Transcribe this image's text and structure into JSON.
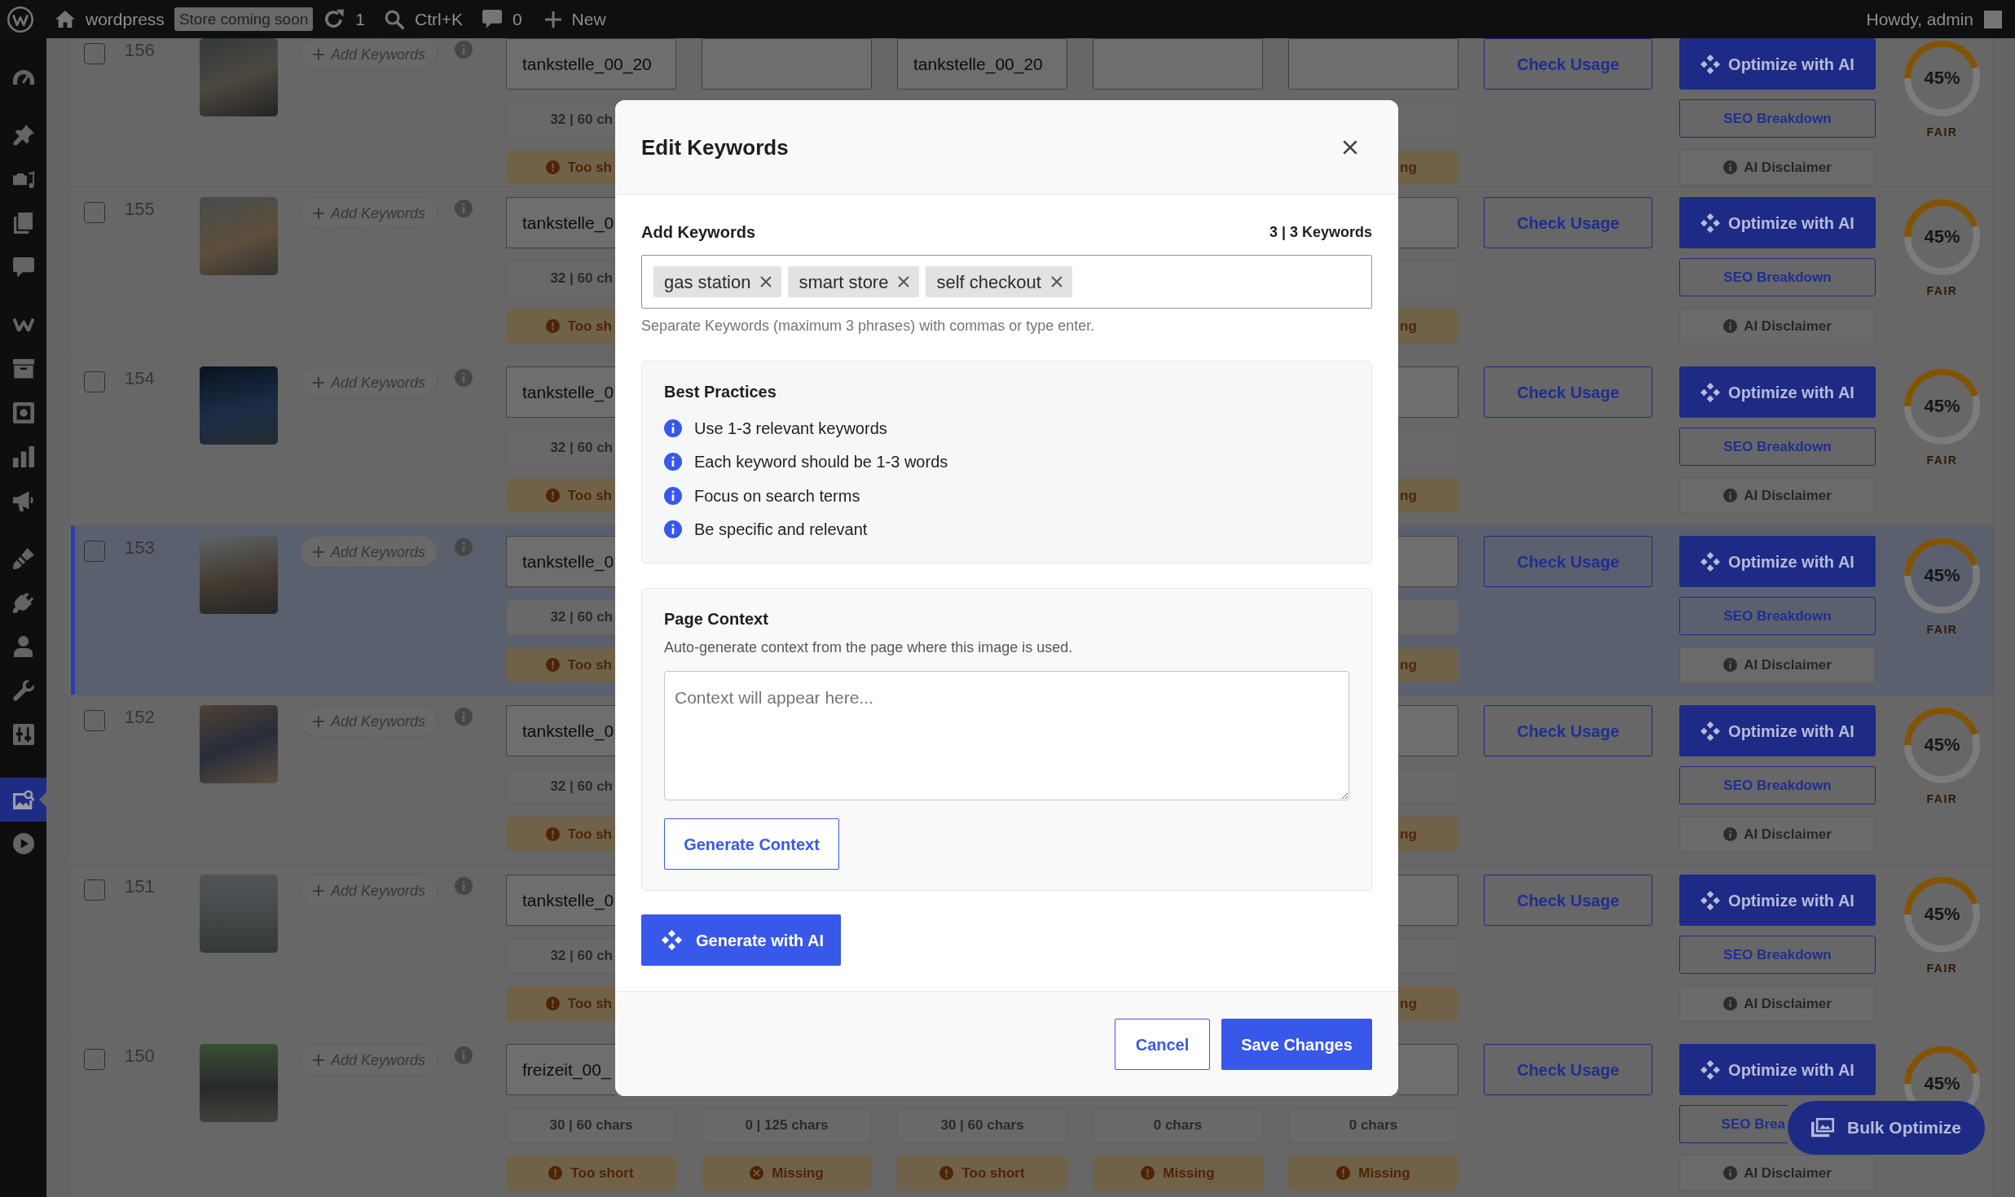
{
  "admin_bar": {
    "site_name": "wordpress",
    "badge": "Store coming soon",
    "updates": "1",
    "search_hint": "Ctrl+K",
    "comments": "0",
    "new_label": "New",
    "greeting": "Howdy, admin"
  },
  "admin_menu": {
    "groups": [
      {
        "items": [
          {
            "selected": false
          }
        ]
      },
      {
        "items": [
          {
            "selected": false
          },
          {
            "selected": false
          },
          {
            "selected": false
          },
          {
            "selected": false
          }
        ]
      },
      {
        "items": [
          {
            "selected": false
          },
          {
            "selected": false
          },
          {
            "selected": false
          },
          {
            "selected": false
          },
          {
            "selected": false
          }
        ]
      },
      {
        "items": [
          {
            "selected": false
          },
          {
            "selected": false
          },
          {
            "selected": false
          },
          {
            "selected": false
          },
          {
            "selected": false
          }
        ]
      },
      {
        "items": [
          {
            "selected": true
          },
          {
            "selected": false
          }
        ]
      }
    ]
  },
  "rows": [
    {
      "number": "156",
      "checked": false,
      "selected": false,
      "keywords_button": "Add Keywords",
      "column_1": {
        "value": "tankstelle_00_20",
        "count": "32 | 60 ch",
        "status": "Too sh",
        "kind": "warning"
      },
      "column_3": {
        "value": "tankstelle_00_20"
      },
      "column_5": {
        "status": "ng"
      },
      "usage_button": "Check Usage",
      "optimize_button": "Optimize with AI",
      "breakdown_button": "SEO Breakdown",
      "disclaimer_button": "AI Disclaimer",
      "score": {
        "value": "45%",
        "level": 0.45,
        "rating": "FAIR"
      }
    },
    {
      "number": "155",
      "checked": false,
      "selected": false,
      "keywords_button": "Add Keywords",
      "column_1": {
        "value": "tankstelle_0",
        "count": "32 | 60 ch",
        "status": "Too sh",
        "kind": "warning"
      },
      "column_5": {
        "status": "ng"
      },
      "usage_button": "Check Usage",
      "optimize_button": "Optimize with AI",
      "breakdown_button": "SEO Breakdown",
      "disclaimer_button": "AI Disclaimer",
      "score": {
        "value": "45%",
        "level": 0.45,
        "rating": "FAIR"
      }
    },
    {
      "number": "154",
      "checked": false,
      "selected": false,
      "keywords_button": "Add Keywords",
      "column_1": {
        "value": "tankstelle_0",
        "count": "32 | 60 ch",
        "status": "Too sh",
        "kind": "warning"
      },
      "column_5": {
        "status": "ng"
      },
      "usage_button": "Check Usage",
      "optimize_button": "Optimize with AI",
      "breakdown_button": "SEO Breakdown",
      "disclaimer_button": "AI Disclaimer",
      "score": {
        "value": "45%",
        "level": 0.45,
        "rating": "FAIR"
      }
    },
    {
      "number": "153",
      "checked": false,
      "selected": true,
      "keywords_button": "Add Keywords",
      "column_1": {
        "value": "tankstelle_0",
        "count": "32 | 60 ch",
        "status": "Too sh",
        "kind": "warning"
      },
      "column_5": {
        "status": "ng"
      },
      "usage_button": "Check Usage",
      "optimize_button": "Optimize with AI",
      "breakdown_button": "SEO Breakdown",
      "disclaimer_button": "AI Disclaimer",
      "score": {
        "value": "45%",
        "level": 0.45,
        "rating": "FAIR"
      }
    },
    {
      "number": "152",
      "checked": false,
      "selected": false,
      "keywords_button": "Add Keywords",
      "column_1": {
        "value": "tankstelle_0",
        "count": "32 | 60 ch",
        "status": "Too sh",
        "kind": "warning"
      },
      "column_5": {
        "status": "ng"
      },
      "usage_button": "Check Usage",
      "optimize_button": "Optimize with AI",
      "breakdown_button": "SEO Breakdown",
      "disclaimer_button": "AI Disclaimer",
      "score": {
        "value": "45%",
        "level": 0.45,
        "rating": "FAIR"
      }
    },
    {
      "number": "151",
      "checked": false,
      "selected": false,
      "keywords_button": "Add Keywords",
      "column_1": {
        "value": "tankstelle_0",
        "count": "32 | 60 ch",
        "status": "Too sh",
        "kind": "warning"
      },
      "column_5": {
        "status": "ng"
      },
      "usage_button": "Check Usage",
      "optimize_button": "Optimize with AI",
      "breakdown_button": "SEO Breakdown",
      "disclaimer_button": "AI Disclaimer",
      "score": {
        "value": "45%",
        "level": 0.45,
        "rating": "FAIR"
      }
    },
    {
      "number": "150",
      "checked": false,
      "selected": false,
      "keywords_button": "Add Keywords",
      "column_1": {
        "value": "freizeit_00_",
        "count": "30 | 60 chars",
        "status": "Too short",
        "kind": "warning"
      },
      "column_2": {
        "count": "0 | 125 chars",
        "status": "Missing",
        "kind": "error"
      },
      "column_3": {
        "count": "30 | 60 chars",
        "status": "Too short",
        "kind": "warning"
      },
      "column_4": {
        "count": "0 chars",
        "status": "Missing",
        "kind": "warning"
      },
      "column_5": {
        "count": "0 chars",
        "status": "Missing",
        "kind": "warning"
      },
      "usage_button": "Check Usage",
      "optimize_button": "Optimize with AI",
      "breakdown_button": "SEO Brea",
      "disclaimer_button": "AI Disclaimer",
      "score": {
        "value": "45%",
        "level": 0.45
      }
    }
  ],
  "dialog": {
    "title": "Edit Keywords",
    "keywords_label": "Add Keywords",
    "keyword_count": "3 | 3 Keywords",
    "keywords": [
      "gas station",
      "smart store",
      "self checkout"
    ],
    "help": "Separate Keywords (maximum 3 phrases) with commas or type enter.",
    "tips": {
      "title": "Best Practices",
      "items": [
        "Use 1-3 relevant keywords",
        "Each keyword should be 1-3 words",
        "Focus on search terms",
        "Be specific and relevant"
      ]
    },
    "context": {
      "title": "Page Context",
      "description": "Auto-generate context from the page where this image is used.",
      "placeholder": "Context will appear here...",
      "button": "Generate Context"
    },
    "ai_button": "Generate with AI",
    "buttons": {
      "cancel": "Cancel",
      "save": "Save Changes"
    }
  },
  "bulk_button": "Bulk Optimize"
}
